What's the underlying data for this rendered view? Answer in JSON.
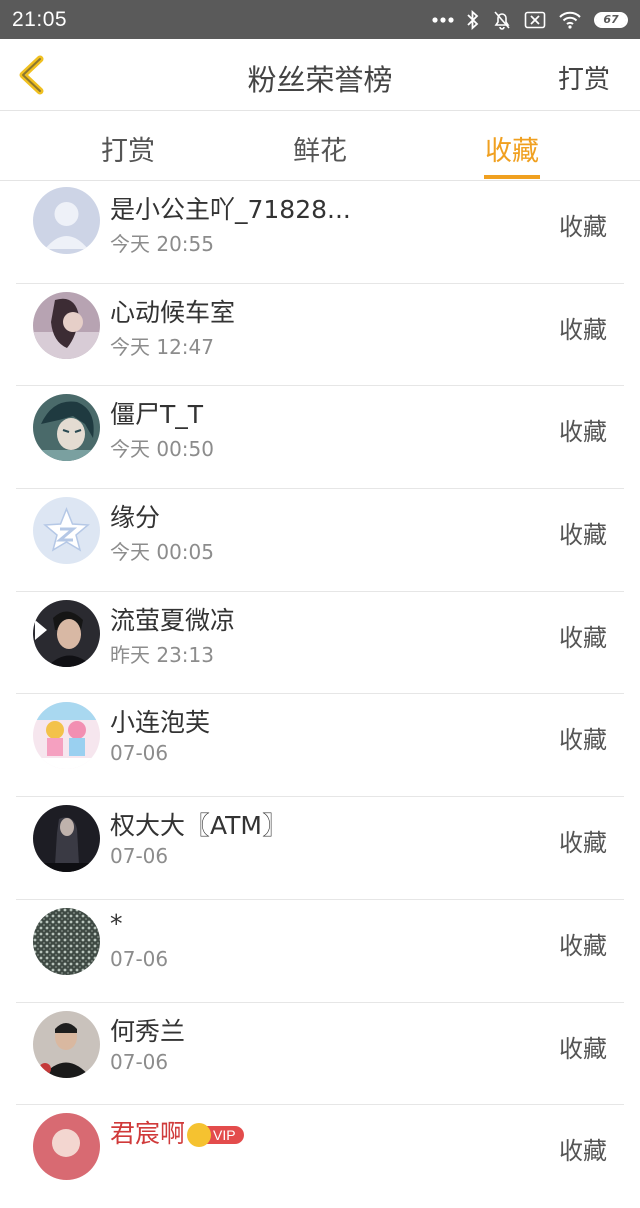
{
  "status_bar": {
    "time": "21:05",
    "battery": "67",
    "icons": [
      "more-dots-icon",
      "bluetooth-icon",
      "mute-bell-icon",
      "sim-off-icon",
      "wifi-icon",
      "battery-icon"
    ]
  },
  "header": {
    "title": "粉丝荣誉榜",
    "back_icon": "chevron-left-icon",
    "right_label": "打赏",
    "accent_color": "#f0a020"
  },
  "tabs": [
    {
      "label": "打赏",
      "active": false
    },
    {
      "label": "鲜花",
      "active": false
    },
    {
      "label": "收藏",
      "active": true
    }
  ],
  "fans": [
    {
      "name": "是小公主吖_71828...",
      "time": "今天 20:55",
      "action": "收藏",
      "avatar": "default-avatar"
    },
    {
      "name": "心动候车室",
      "time": "今天 12:47",
      "action": "收藏",
      "avatar": "user-photo"
    },
    {
      "name": "僵尸T_T",
      "time": "今天 00:50",
      "action": "收藏",
      "avatar": "anime-avatar"
    },
    {
      "name": "缘分",
      "time": "今天 00:05",
      "action": "收藏",
      "avatar": "qzone-star-avatar"
    },
    {
      "name": "流萤夏微凉",
      "time": "昨天 23:13",
      "action": "收藏",
      "avatar": "user-photo"
    },
    {
      "name": "小连泡芙",
      "time": "07-06",
      "action": "收藏",
      "avatar": "anime-avatar"
    },
    {
      "name": "权大大〖ATM〗",
      "time": "07-06",
      "action": "收藏",
      "avatar": "user-photo"
    },
    {
      "name": "*",
      "time": "07-06",
      "action": "收藏",
      "avatar": "pattern-avatar"
    },
    {
      "name": "何秀兰",
      "time": "07-06",
      "action": "收藏",
      "avatar": "user-photo"
    },
    {
      "name": "君宸啊",
      "time": "",
      "action": "收藏",
      "avatar": "user-photo",
      "vip_label": "VIP"
    }
  ]
}
